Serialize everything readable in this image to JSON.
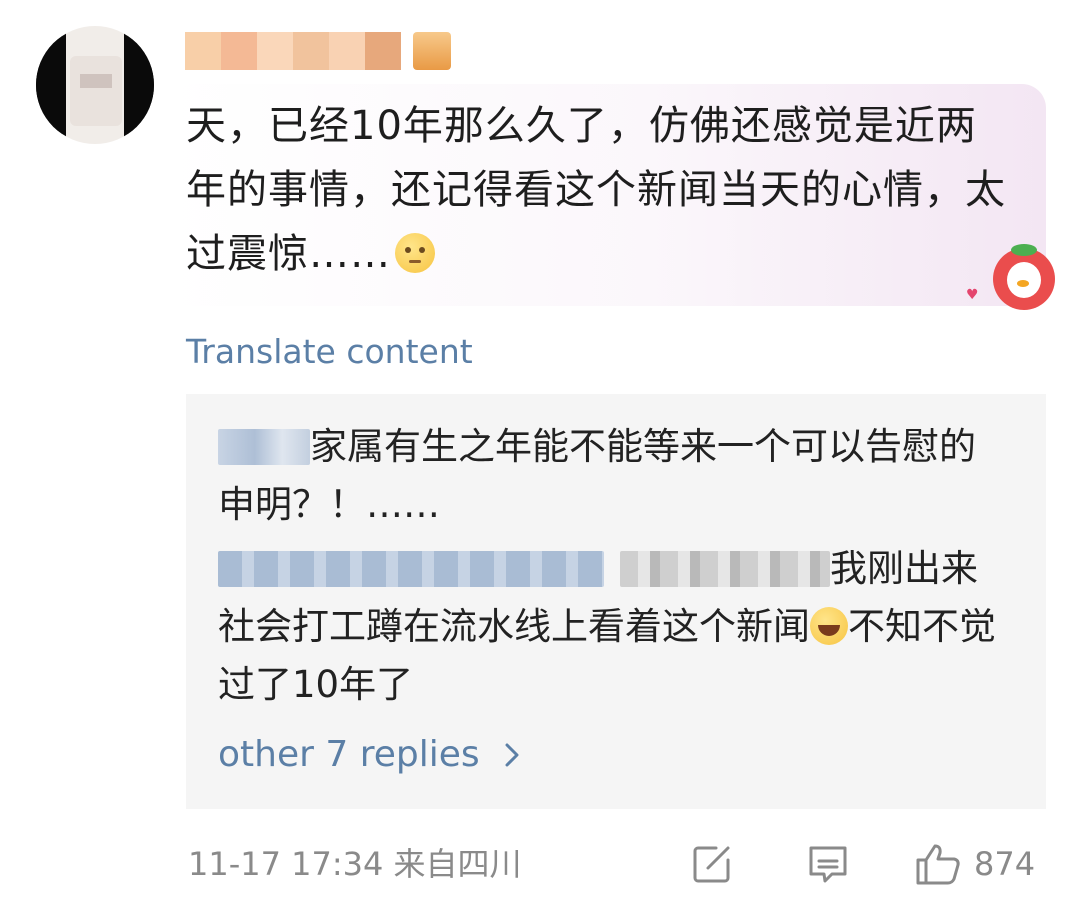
{
  "comment": {
    "username_redacted": true,
    "text": "天，已经10年那么久了，仿佛还感觉是近两年的事情，还记得看这个新闻当天的心情，太过震惊……",
    "emoji": "pleading-face",
    "translate_label": "Translate content"
  },
  "replies": [
    {
      "username_redacted": true,
      "text": "家属有生之年能不能等来一个可以告慰的申明？！……"
    },
    {
      "username_redacted": true,
      "text_before": "我刚出来社会打工蹲在流水线上看着这个新闻",
      "emoji": "tears-of-joy",
      "text_after": "不知不觉过了10年了"
    }
  ],
  "more_replies_label": "other 7 replies",
  "footer": {
    "timestamp": "11-17 17:34 来自四川",
    "like_count": "874"
  },
  "icons": [
    "share-edit-icon",
    "comment-icon",
    "thumbs-up-icon",
    "chevron-right-icon"
  ],
  "colors": {
    "link": "#5b7fa6",
    "meta": "#8a8a8a",
    "reply_bg": "#f5f5f5"
  }
}
